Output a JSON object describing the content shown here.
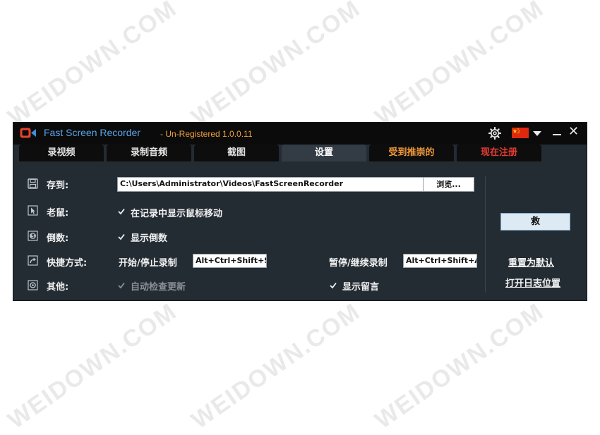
{
  "watermark": "WEIDOWN.COM",
  "window": {
    "title": "Fast Screen Recorder",
    "version": "- Un-Registered 1.0.0.11"
  },
  "tabs": [
    {
      "label": "录视频",
      "state": "normal"
    },
    {
      "label": "录制音频",
      "state": "normal"
    },
    {
      "label": "截图",
      "state": "normal"
    },
    {
      "label": "设置",
      "state": "active"
    },
    {
      "label": "受到推崇的",
      "state": "orange"
    },
    {
      "label": "现在注册",
      "state": "red"
    }
  ],
  "settings": {
    "save_to": {
      "label": "存到:",
      "path": "C:\\Users\\Administrator\\Videos\\FastScreenRecorder",
      "browse": "浏览..."
    },
    "mouse": {
      "label": "老鼠:",
      "option": "在记录中显示鼠标移动",
      "checked": true
    },
    "countdown": {
      "label": "倒数:",
      "option": "显示倒数",
      "checked": true
    },
    "hotkeys": {
      "label": "快捷方式:",
      "start_label": "开始/停止录制",
      "start_value": "Alt+Ctrl+Shift+S",
      "pause_label": "暂停/继续录制",
      "pause_value": "Alt+Ctrl+Shift+A"
    },
    "other": {
      "label": "其他:",
      "auto_update": "自动检查更新",
      "auto_update_checked": true,
      "auto_update_disabled": true,
      "show_notes": "显示留言",
      "show_notes_checked": true
    }
  },
  "side": {
    "save_button": "救",
    "reset_link": "重置为默认",
    "log_link": "打开日志位置"
  },
  "icons": {
    "app": "camera-icon",
    "settings": "gear-icon",
    "language": "china-flag-icon",
    "save_to": "floppy-disk-icon",
    "mouse": "cursor-icon",
    "countdown": "countdown-icon",
    "hotkeys": "shortcut-arrow-icon",
    "other": "cog-icon"
  },
  "colors": {
    "title": "#5aa6ea",
    "version": "#f0a23a",
    "tab_orange": "#f09a3a",
    "tab_red": "#e63c32",
    "background": "#232b33",
    "titlebar": "#0b0b0b"
  }
}
